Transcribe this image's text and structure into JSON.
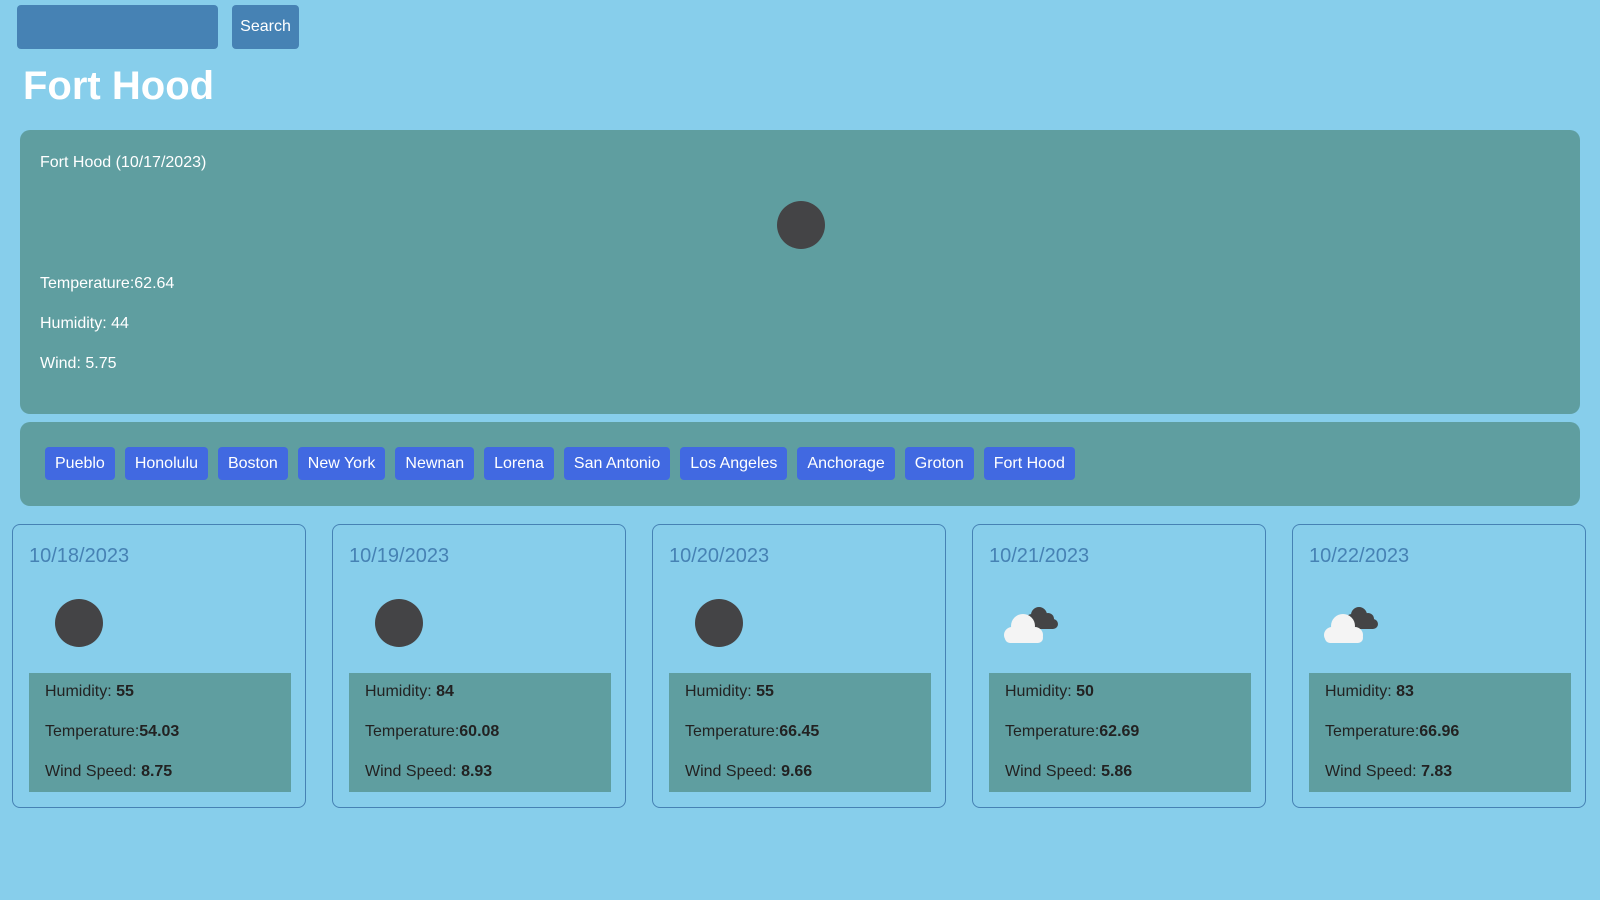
{
  "search": {
    "input_value": "",
    "button_label": "Search"
  },
  "city_title": "Fort Hood",
  "current": {
    "heading": "Fort Hood (10/17/2023)",
    "icon": "moon-icon",
    "temperature_label": "Temperature:",
    "temperature": "62.64",
    "humidity_label": "Humidity: ",
    "humidity": "44",
    "wind_label": "Wind: ",
    "wind": "5.75"
  },
  "history": [
    "Pueblo",
    "Honolulu",
    "Boston",
    "New York",
    "Newnan",
    "Lorena",
    "San Antonio",
    "Los Angeles",
    "Anchorage",
    "Groton",
    "Fort Hood"
  ],
  "labels": {
    "humidity": "Humidity: ",
    "temperature": "Temperature:",
    "wind_speed": "Wind Speed: "
  },
  "forecast": [
    {
      "date": "10/18/2023",
      "icon": "moon-icon",
      "humidity": "55",
      "temperature": "54.03",
      "wind_speed": "8.75"
    },
    {
      "date": "10/19/2023",
      "icon": "moon-icon",
      "humidity": "84",
      "temperature": "60.08",
      "wind_speed": "8.93"
    },
    {
      "date": "10/20/2023",
      "icon": "moon-icon",
      "humidity": "55",
      "temperature": "66.45",
      "wind_speed": "9.66"
    },
    {
      "date": "10/21/2023",
      "icon": "clouds-icon",
      "humidity": "50",
      "temperature": "62.69",
      "wind_speed": "5.86"
    },
    {
      "date": "10/22/2023",
      "icon": "clouds-icon",
      "humidity": "83",
      "temperature": "66.96",
      "wind_speed": "7.83"
    }
  ],
  "colors": {
    "background": "#87ceeb",
    "panel": "#5f9ea0",
    "steel_blue": "#4682b4",
    "history_button": "#4169e1",
    "moon": "#444446"
  }
}
